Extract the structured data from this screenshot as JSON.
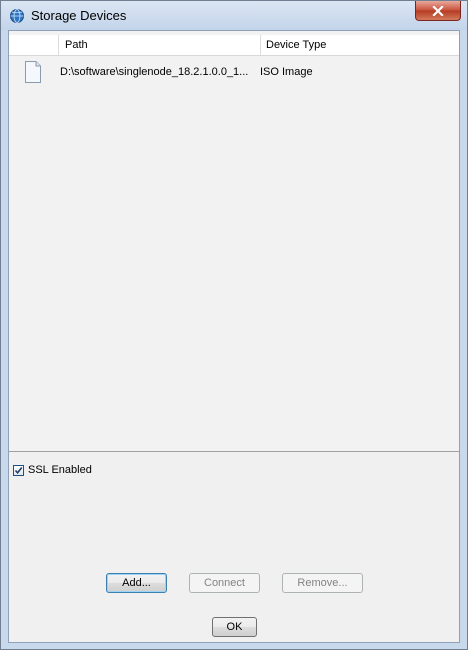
{
  "window": {
    "title": "Storage Devices",
    "close_icon": "close-icon"
  },
  "table": {
    "columns": [
      "",
      "Path",
      "Device Type"
    ],
    "rows": [
      {
        "icon": "file-icon",
        "path": "D:\\software\\singlenode_18.2.1.0.0_1...",
        "device_type": "ISO Image"
      }
    ]
  },
  "ssl": {
    "label": "SSL Enabled",
    "checked": true
  },
  "buttons": {
    "add": "Add...",
    "connect": "Connect",
    "remove": "Remove...",
    "ok": "OK"
  },
  "colors": {
    "close_button": "#c7503a",
    "client_bg": "#f0f0f0",
    "frame": "#c9d9ec"
  }
}
